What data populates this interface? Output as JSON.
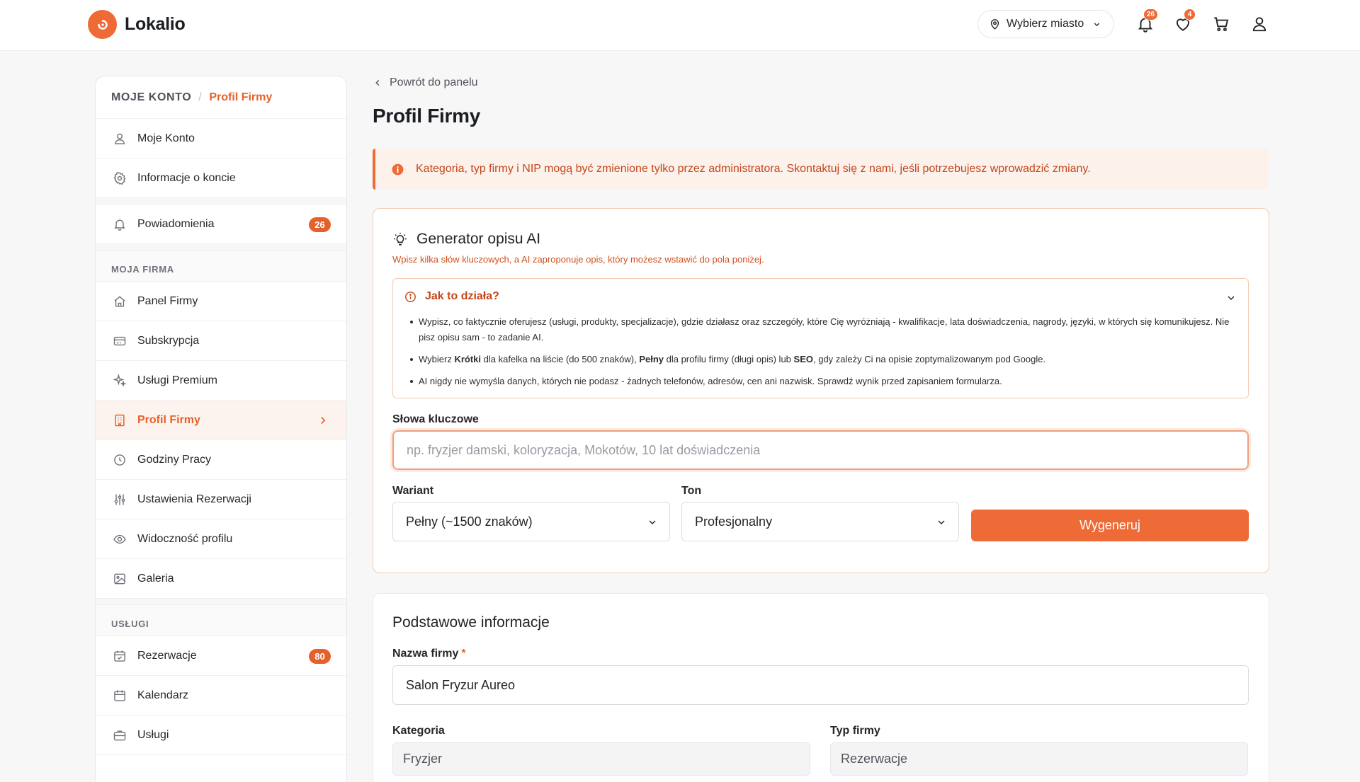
{
  "header": {
    "logo_text": "Lokalio",
    "city_button": "Wybierz miasto",
    "notifications_count": "26",
    "favorites_count": "4"
  },
  "sidebar": {
    "breadcrumb_root": "MOJE KONTO",
    "breadcrumb_sep": "/",
    "breadcrumb_current": "Profil Firmy",
    "account_items": [
      {
        "label": "Moje Konto",
        "icon": "user-icon"
      },
      {
        "label": "Informacje o koncie",
        "icon": "gear-icon"
      }
    ],
    "notifications_item": {
      "label": "Powiadomienia",
      "badge": "26",
      "icon": "bell-icon"
    },
    "company_header": "MOJA FIRMA",
    "company_items": [
      {
        "label": "Panel Firmy",
        "icon": "home-icon"
      },
      {
        "label": "Subskrypcja",
        "icon": "credit-card-icon"
      },
      {
        "label": "Usługi Premium",
        "icon": "sparkle-icon"
      },
      {
        "label": "Profil Firmy",
        "icon": "building-icon",
        "active": true
      },
      {
        "label": "Godziny Pracy",
        "icon": "clock-icon"
      },
      {
        "label": "Ustawienia Rezerwacji",
        "icon": "sliders-icon"
      },
      {
        "label": "Widoczność profilu",
        "icon": "eye-icon"
      },
      {
        "label": "Galeria",
        "icon": "image-icon"
      }
    ],
    "services_header": "USŁUGI",
    "services_items": [
      {
        "label": "Rezerwacje",
        "badge": "80",
        "icon": "calendar-check-icon"
      },
      {
        "label": "Kalendarz",
        "icon": "calendar-icon"
      },
      {
        "label": "Usługi",
        "icon": "briefcase-icon"
      }
    ]
  },
  "main": {
    "back_link": "Powrót do panelu",
    "page_title": "Profil Firmy",
    "alert_text": "Kategoria, typ firmy i NIP mogą być zmienione tylko przez administratora. Skontaktuj się z nami, jeśli potrzebujesz wprowadzić zmiany.",
    "ai": {
      "title": "Generator opisu AI",
      "subtitle": "Wpisz kilka słów kluczowych, a AI zaproponuje opis, który możesz wstawić do pola poniżej.",
      "how_title": "Jak to działa?",
      "bullet1": "Wypisz, co faktycznie oferujesz (usługi, produkty, specjalizacje), gdzie działasz oraz szczegóły, które Cię wyróżniają - kwalifikacje, lata doświadczenia, nagrody, języki, w których się komunikujesz. Nie pisz opisu sam - to zadanie AI.",
      "bullet2_a": "Wybierz ",
      "bullet2_b": "Krótki",
      "bullet2_c": " dla kafelka na liście (do 500 znaków), ",
      "bullet2_d": "Pełny",
      "bullet2_e": " dla profilu firmy (długi opis) lub ",
      "bullet2_f": "SEO",
      "bullet2_g": ", gdy zależy Ci na opisie zoptymalizowanym pod Google.",
      "bullet3": "AI nigdy nie wymyśla danych, których nie podasz - żadnych telefonów, adresów, cen ani nazwisk. Sprawdź wynik przed zapisaniem formularza.",
      "keywords_label": "Słowa kluczowe",
      "keywords_placeholder": "np. fryzjer damski, koloryzacja, Mokotów, 10 lat doświadczenia",
      "variant_label": "Wariant",
      "variant_value": "Pełny (~1500 znaków)",
      "tone_label": "Ton",
      "tone_value": "Profesjonalny",
      "generate_button": "Wygeneruj"
    },
    "basic": {
      "title": "Podstawowe informacje",
      "name_label": "Nazwa firmy",
      "name_required": "*",
      "name_value": "Salon Fryzur Aureo",
      "category_label": "Kategoria",
      "category_value": "Fryzjer",
      "type_label": "Typ firmy",
      "type_value": "Rezerwacje"
    }
  },
  "colors": {
    "accent": "#ee6a37",
    "accent_text": "#e5612c",
    "alert_bg": "#fdf1ec"
  }
}
